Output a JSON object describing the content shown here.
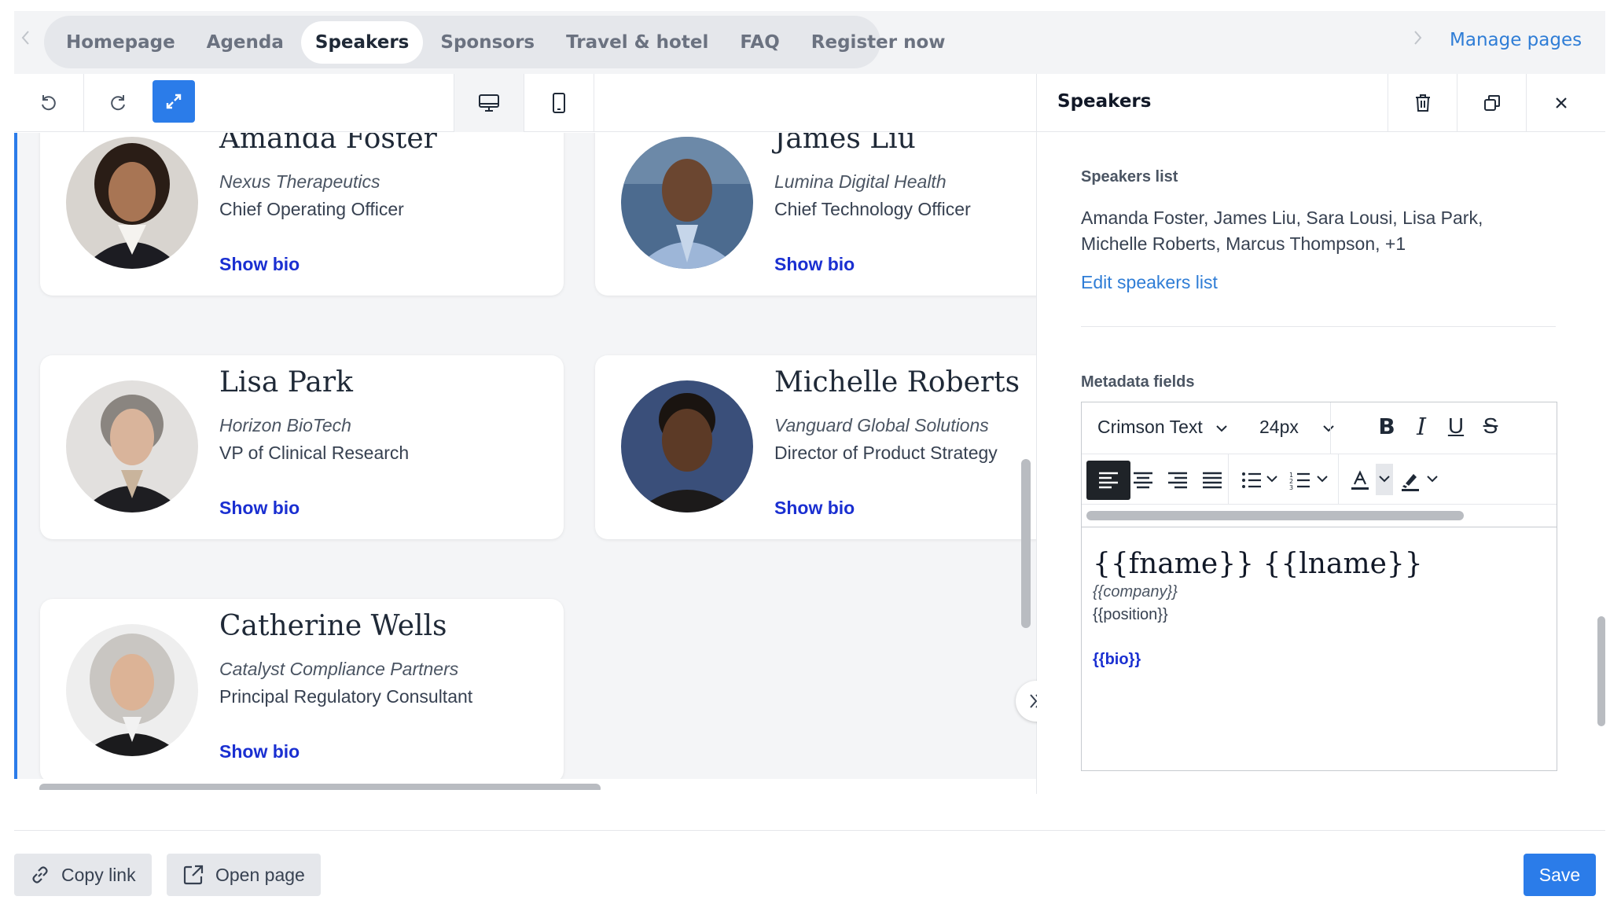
{
  "tabs": [
    {
      "label": "Homepage"
    },
    {
      "label": "Agenda"
    },
    {
      "label": "Speakers"
    },
    {
      "label": "Sponsors"
    },
    {
      "label": "Travel & hotel"
    },
    {
      "label": "FAQ"
    },
    {
      "label": "Register now"
    }
  ],
  "active_tab": "Speakers",
  "manage_pages_label": "Manage pages",
  "speakers": [
    {
      "name": "Amanda Foster",
      "company": "Nexus Therapeutics",
      "position": "Chief Operating Officer",
      "bio_label": "Show bio"
    },
    {
      "name": "James Liu",
      "company": "Lumina Digital Health",
      "position": "Chief Technology Officer",
      "bio_label": "Show bio"
    },
    {
      "name": "Lisa Park",
      "company": "Horizon BioTech",
      "position": "VP of Clinical Research",
      "bio_label": "Show bio"
    },
    {
      "name": "Michelle Roberts",
      "company": "Vanguard Global Solutions",
      "position": "Director of Product Strategy",
      "bio_label": "Show bio"
    },
    {
      "name": "Catherine Wells",
      "company": "Catalyst Compliance Partners",
      "position": "Principal Regulatory Consultant",
      "bio_label": "Show bio"
    }
  ],
  "panel": {
    "title": "Speakers",
    "speakers_list_label": "Speakers list",
    "speakers_summary": "Amanda Foster, James Liu, Sara Lousi, Lisa Park, Michelle Roberts, Marcus Thompson, +1",
    "edit_list_label": "Edit speakers list",
    "metadata_label": "Metadata fields",
    "editor": {
      "font": "Crimson Text",
      "size": "24px",
      "template": {
        "name": "{{fname}} {{lname}}",
        "company": "{{company}}",
        "position": "{{position}}",
        "bio": "{{bio}}"
      }
    }
  },
  "footer": {
    "copy_link": "Copy link",
    "open_page": "Open page",
    "save": "Save"
  },
  "colors": {
    "accent": "#2b7ce9",
    "link": "#2f7dd6",
    "bio_link": "#1a2fd1"
  }
}
